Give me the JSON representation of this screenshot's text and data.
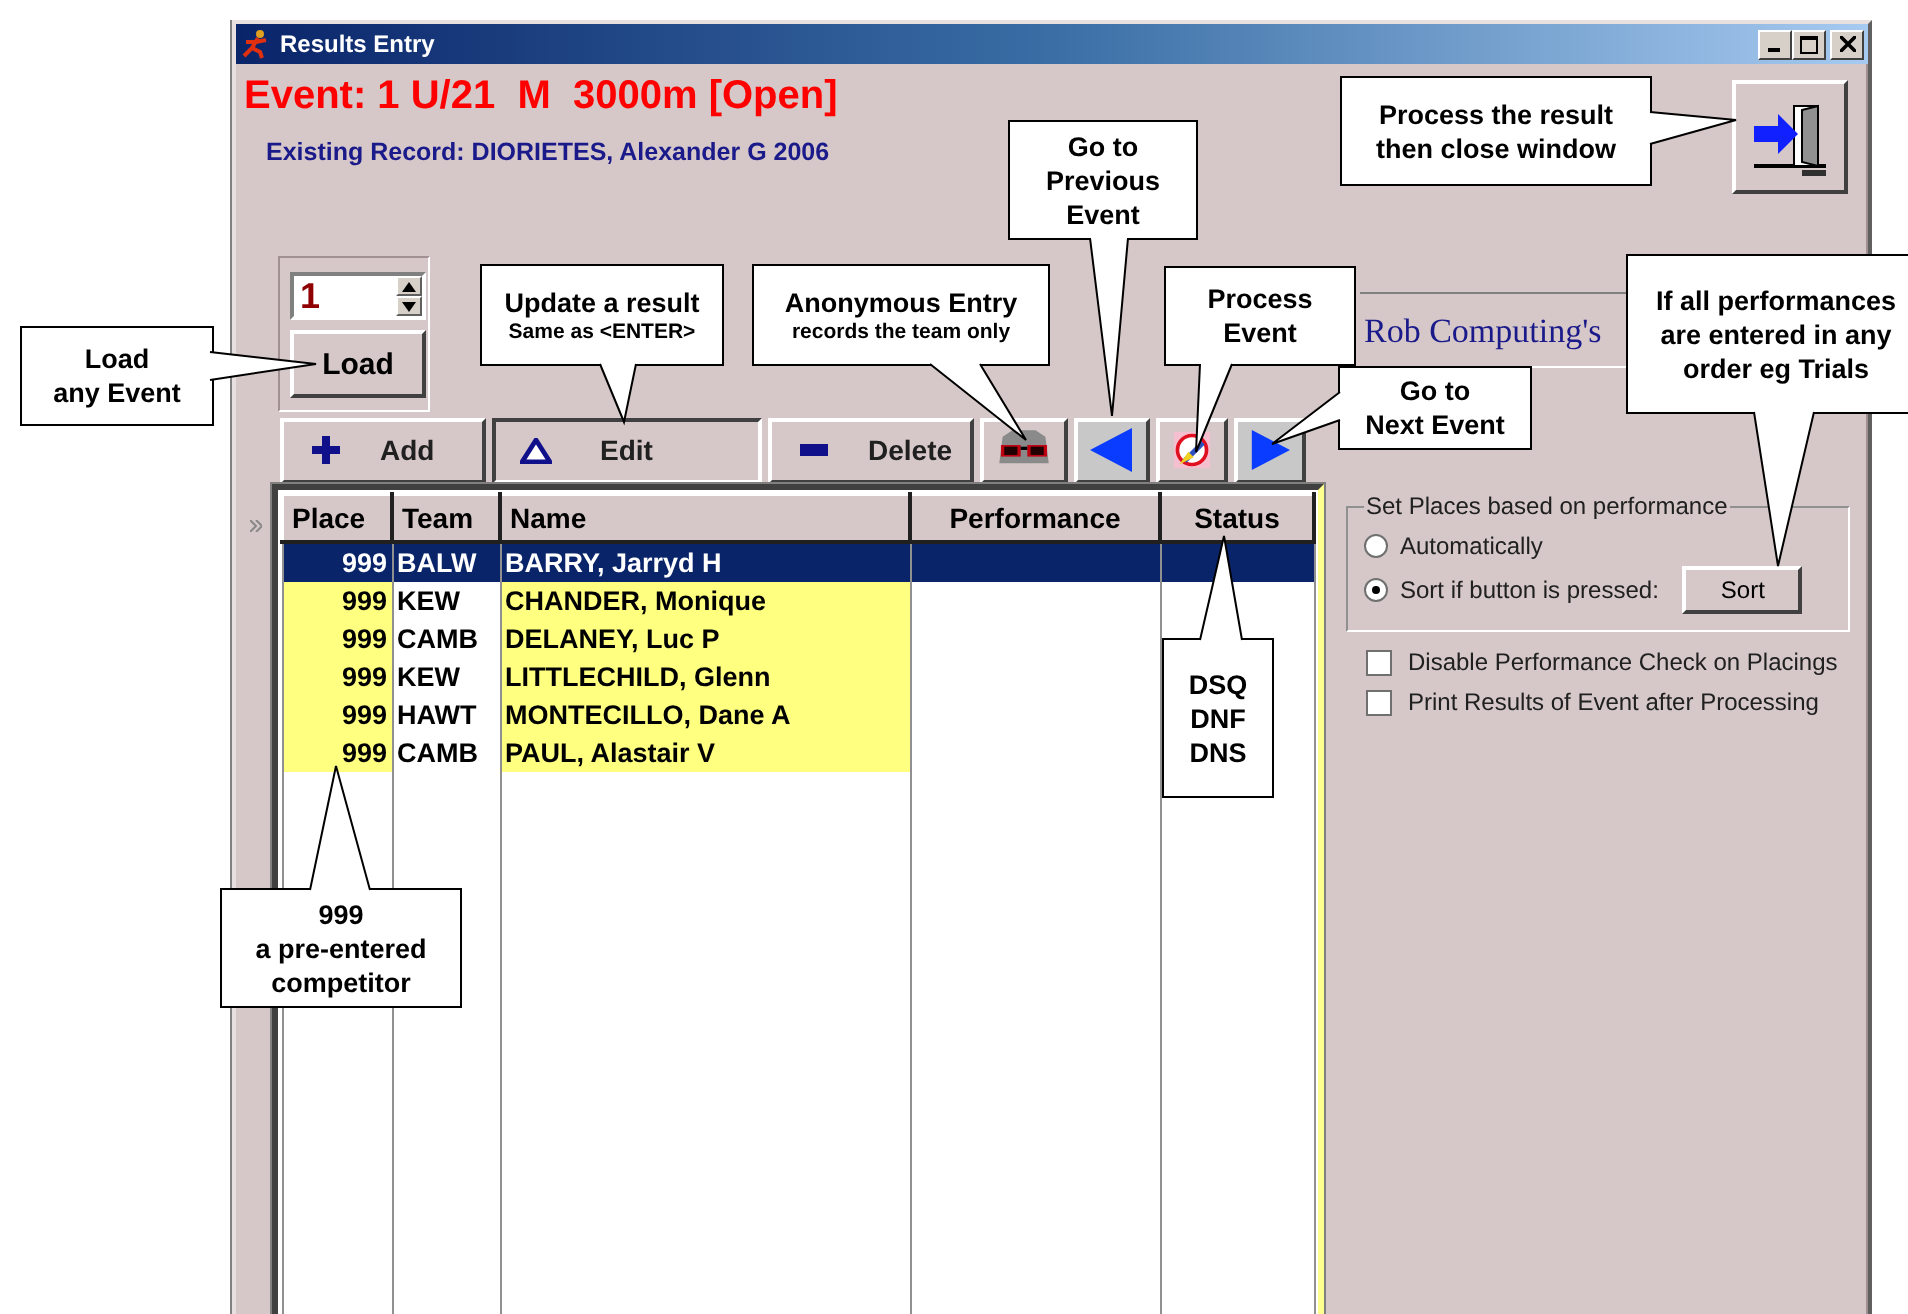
{
  "window": {
    "title": "Results Entry"
  },
  "event_title": "Event: 1 U/21  M  3000m [Open]",
  "record": "Existing Record: DIORIETES, Alexander G 2006",
  "event_number": "1",
  "load_button": "Load",
  "banner": "Rob Computing's",
  "toolbar": [
    {
      "kind": "add",
      "label": "Add"
    },
    {
      "kind": "edit",
      "label": "Edit"
    },
    {
      "kind": "delete",
      "label": "Delete"
    },
    {
      "kind": "anonymous"
    },
    {
      "kind": "previous"
    },
    {
      "kind": "process"
    },
    {
      "kind": "next"
    }
  ],
  "grid": {
    "columns": [
      "Place",
      "Team",
      "Name",
      "Performance",
      "Status"
    ],
    "rows": [
      {
        "place": "999",
        "team": "BALW",
        "name": "BARRY, Jarryd H",
        "selected": true,
        "highlighted": false
      },
      {
        "place": "999",
        "team": "KEW",
        "name": "CHANDER, Monique",
        "selected": false,
        "highlighted": true
      },
      {
        "place": "999",
        "team": "CAMB",
        "name": "DELANEY, Luc P",
        "selected": false,
        "highlighted": true
      },
      {
        "place": "999",
        "team": "KEW",
        "name": "LITTLECHILD, Glenn",
        "selected": false,
        "highlighted": true
      },
      {
        "place": "999",
        "team": "HAWT",
        "name": "MONTECILLO, Dane A",
        "selected": false,
        "highlighted": true
      },
      {
        "place": "999",
        "team": "CAMB",
        "name": "PAUL, Alastair V",
        "selected": false,
        "highlighted": true
      }
    ]
  },
  "places_group": {
    "title": "Set Places based on performance",
    "options": [
      {
        "label": "Automatically",
        "selected": false
      },
      {
        "label": "Sort if button is pressed:",
        "selected": true
      }
    ],
    "sort_button": "Sort"
  },
  "checkboxes": [
    {
      "label": "Disable Performance Check on Placings",
      "checked": false
    },
    {
      "label": "Print Results of Event after Processing",
      "checked": false
    }
  ],
  "callouts": [
    {
      "text": "Go to\nPrevious\nEvent"
    },
    {
      "text": "Process the result\nthen close window"
    },
    {
      "text": "Load\nany Event"
    },
    {
      "text": "Update a result",
      "note": "Same as <ENTER>"
    },
    {
      "text": "Anonymous Entry",
      "note": "records the team only"
    },
    {
      "text": "Process\nEvent"
    },
    {
      "text": "Go to\nNext Event"
    },
    {
      "text": "If all performances\nare entered in any\norder eg Trials"
    },
    {
      "text": "DSQ\nDNF\nDNS"
    },
    {
      "text": "999\na pre-entered\ncompetitor"
    }
  ]
}
